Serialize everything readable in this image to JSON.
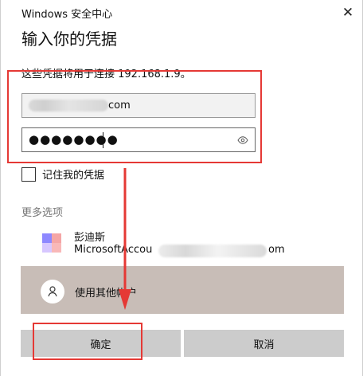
{
  "window": {
    "title": "Windows 安全中心",
    "close_glyph": "✕"
  },
  "dialog": {
    "heading": "输入你的凭据",
    "description": "这些凭据将用于连接 192.168.1.9。",
    "username": {
      "visible_suffix": "com"
    },
    "password": {
      "masked_value": "●●●●●●●●"
    },
    "remember_label": "记住我的凭据",
    "more_options_label": "更多选项",
    "account": {
      "name": "彭迪斯",
      "email_prefix": "MicrosoftAccou",
      "email_suffix": "om"
    },
    "other_account_label": "使用其他帐户",
    "buttons": {
      "ok": "确定",
      "cancel": "取消"
    }
  },
  "icons": {
    "close": "close-icon",
    "reveal_password": "eye-icon",
    "account_logo": "microsoft-account-icon",
    "avatar": "person-icon",
    "arrow": "down-arrow-icon"
  },
  "colors": {
    "annotation_red": "#e53935",
    "selected_option_bg": "#c8bdb7",
    "button_bg": "#cccccc",
    "muted_text": "#777777"
  }
}
